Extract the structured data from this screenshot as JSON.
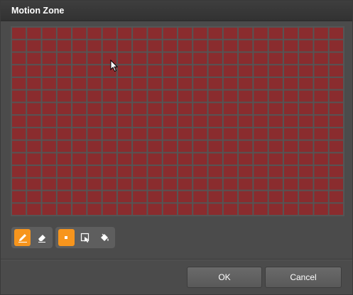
{
  "dialog": {
    "title": "Motion Zone"
  },
  "grid": {
    "rows": 15,
    "cols": 22,
    "cell_color": "#8a2c2e",
    "gap_color": "#555555"
  },
  "tools": {
    "group1": [
      {
        "icon": "pencil-icon",
        "active": true
      },
      {
        "icon": "eraser-icon",
        "active": false
      }
    ],
    "group2": [
      {
        "icon": "single-cell-icon",
        "active": true
      },
      {
        "icon": "rectangle-select-icon",
        "active": false
      },
      {
        "icon": "fill-bucket-icon",
        "active": false
      }
    ],
    "accent_color": "#f7951d"
  },
  "buttons": {
    "ok": "OK",
    "cancel": "Cancel"
  }
}
